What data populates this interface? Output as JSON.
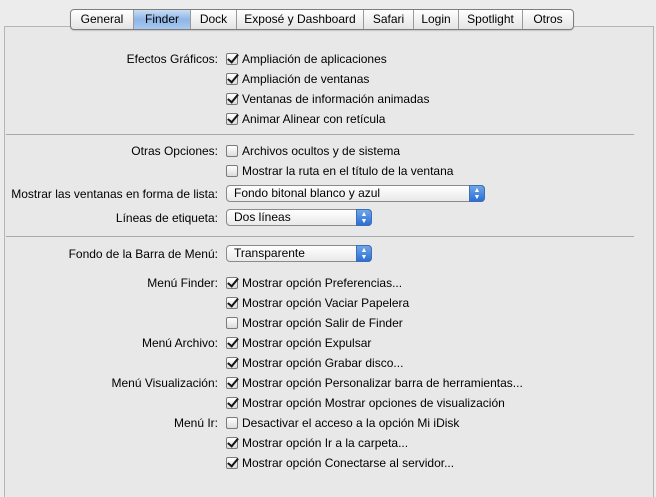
{
  "tabs": [
    "General",
    "Finder",
    "Dock",
    "Exposé y Dashboard",
    "Safari",
    "Login",
    "Spotlight",
    "Otros"
  ],
  "active_tab": "Finder",
  "efectos": {
    "label": "Efectos Gráficos:",
    "items": [
      {
        "text": "Ampliación de aplicaciones",
        "checked": true
      },
      {
        "text": "Ampliación de ventanas",
        "checked": true
      },
      {
        "text": "Ventanas de información animadas",
        "checked": true
      },
      {
        "text": "Animar Alinear con retícula",
        "checked": true
      }
    ]
  },
  "otras": {
    "label": "Otras Opciones:",
    "items": [
      {
        "text": "Archivos ocultos y de sistema",
        "checked": false
      },
      {
        "text": "Mostrar la ruta en el título de la ventana",
        "checked": false
      }
    ]
  },
  "lista": {
    "label": "Mostrar las ventanas en forma de lista:",
    "value": "Fondo bitonal blanco y azul"
  },
  "lineas": {
    "label": "Líneas de etiqueta:",
    "value": "Dos líneas"
  },
  "barra": {
    "label": "Fondo de la Barra de Menú:",
    "value": "Transparente"
  },
  "menu_finder": {
    "label": "Menú Finder:",
    "items": [
      {
        "text": "Mostrar opción Preferencias...",
        "checked": true
      },
      {
        "text": "Mostrar opción Vaciar Papelera",
        "checked": true
      },
      {
        "text": "Mostrar opción Salir de Finder",
        "checked": false
      }
    ]
  },
  "menu_archivo": {
    "label": "Menú Archivo:",
    "items": [
      {
        "text": "Mostrar opción Expulsar",
        "checked": true
      },
      {
        "text": "Mostrar opción Grabar disco...",
        "checked": true
      }
    ]
  },
  "menu_visualizacion": {
    "label": "Menú Visualización:",
    "items": [
      {
        "text": "Mostrar opción Personalizar barra de herramientas...",
        "checked": true
      },
      {
        "text": "Mostrar opción Mostrar opciones de visualización",
        "checked": true
      }
    ]
  },
  "menu_ir": {
    "label": "Menú Ir:",
    "items": [
      {
        "text": "Desactivar el acceso a la opción Mi iDisk",
        "checked": false
      },
      {
        "text": "Mostrar opción Ir a la carpeta...",
        "checked": true
      },
      {
        "text": "Mostrar opción Conectarse al servidor...",
        "checked": true
      }
    ]
  }
}
